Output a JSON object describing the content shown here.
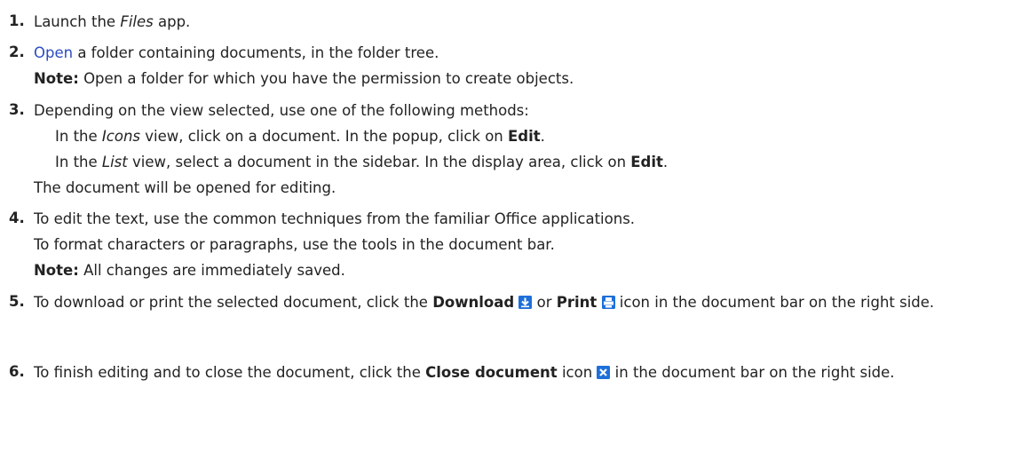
{
  "steps": [
    {
      "num": "1.",
      "a": "Launch the ",
      "app_name": "Files",
      "b": " app."
    },
    {
      "num": "2.",
      "link": "Open",
      "a": " a folder containing documents, in the folder tree.",
      "note_label": "Note:",
      "note_text": " Open a folder for which you have the permission to create objects."
    },
    {
      "num": "3.",
      "a": "Depending on the view selected, use one of the following methods:",
      "m1_a": "In the ",
      "m1_view": "Icons",
      "m1_b": " view, click on a document. In the popup, click on ",
      "m1_bold": "Edit",
      "m1_c": ".",
      "m2_a": "In the ",
      "m2_view": "List",
      "m2_b": " view, select a document in the sidebar. In the display area, click on ",
      "m2_bold": "Edit",
      "m2_c": ".",
      "result": "The document will be opened for editing."
    },
    {
      "num": "4.",
      "a": "To edit the text, use the common techniques from the familiar Office applications.",
      "b": "To format characters or paragraphs, use the tools in the document bar.",
      "note_label": "Note:",
      "note_text": " All changes are immediately saved."
    },
    {
      "num": "5.",
      "a": "To download or print the selected document, click the ",
      "download": "Download",
      "or": " or ",
      "print": "Print",
      "b": " icon in the document bar on the right side."
    },
    {
      "num": "6.",
      "a": "To finish editing and to close the document, click the ",
      "close": "Close document",
      "b": " icon ",
      "c": " in the document bar on the right side."
    }
  ],
  "icons": {
    "download": "download-icon",
    "print": "print-icon",
    "close": "close-icon"
  },
  "colors": {
    "text": "#222222",
    "link": "#2a4cc0",
    "icon_blue": "#1e6fd9"
  }
}
